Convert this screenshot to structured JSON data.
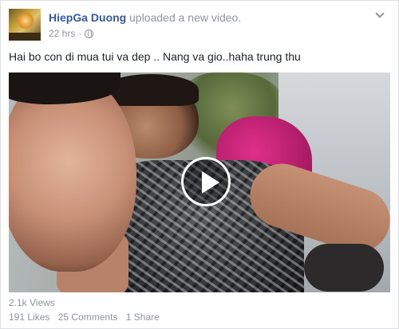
{
  "post": {
    "author": "HiepGa Duong",
    "action": "uploaded a new video.",
    "time": "22 hrs",
    "meta_separator": "·",
    "privacy_icon": "globe-icon",
    "text": "Hai bo con di mua tui va dep .. Nang va gio..haha trung thu"
  },
  "video": {
    "play_icon": "play-icon"
  },
  "stats": {
    "views": "2.1k Views",
    "likes": "191 Likes",
    "comments": "25 Comments",
    "shares": "1 Share"
  },
  "colors": {
    "author_link": "#365899",
    "meta_gray": "#90949c",
    "text": "#1d2129",
    "border": "#dddfe2"
  }
}
